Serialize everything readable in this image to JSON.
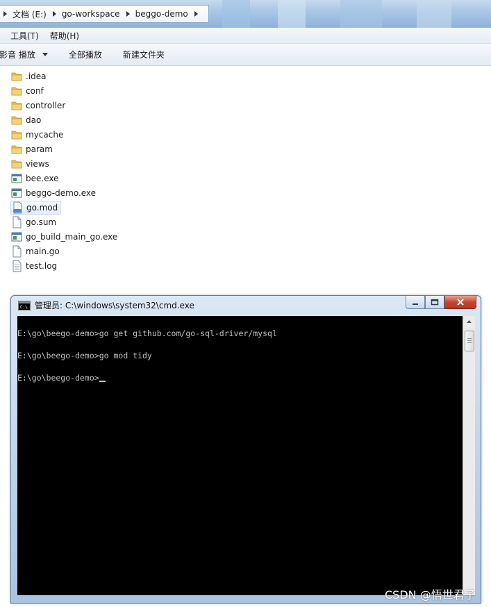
{
  "explorer": {
    "breadcrumb": [
      "文档 (E:)",
      "go-workspace",
      "beggo-demo"
    ],
    "menu": [
      "工具(T)",
      "帮助(H)"
    ],
    "toolbar": {
      "play": "影音 播放",
      "play_all": "全部播放",
      "new_folder": "新建文件夹"
    },
    "files": [
      {
        "name": ".idea",
        "icon": "folder-icon"
      },
      {
        "name": "conf",
        "icon": "folder-icon"
      },
      {
        "name": "controller",
        "icon": "folder-icon"
      },
      {
        "name": "dao",
        "icon": "folder-icon"
      },
      {
        "name": "mycache",
        "icon": "folder-icon"
      },
      {
        "name": "param",
        "icon": "folder-icon"
      },
      {
        "name": "views",
        "icon": "folder-icon"
      },
      {
        "name": "bee.exe",
        "icon": "exe-icon"
      },
      {
        "name": "beggo-demo.exe",
        "icon": "exe-icon"
      },
      {
        "name": "go.mod",
        "icon": "mod-file-icon",
        "selected": true
      },
      {
        "name": "go.sum",
        "icon": "blank-file-icon"
      },
      {
        "name": "go_build_main_go.exe",
        "icon": "exe-icon"
      },
      {
        "name": "main.go",
        "icon": "blank-file-icon"
      },
      {
        "name": "test.log",
        "icon": "text-file-icon"
      }
    ]
  },
  "cmd_window": {
    "title": "管理员: C:\\windows\\system32\\cmd.exe",
    "lines": [
      "E:\\go\\beego-demo>go get github.com/go-sql-driver/mysql",
      "E:\\go\\beego-demo>go mod tidy",
      "E:\\go\\beego-demo>"
    ]
  },
  "watermark": "CSDN @悟世君子"
}
